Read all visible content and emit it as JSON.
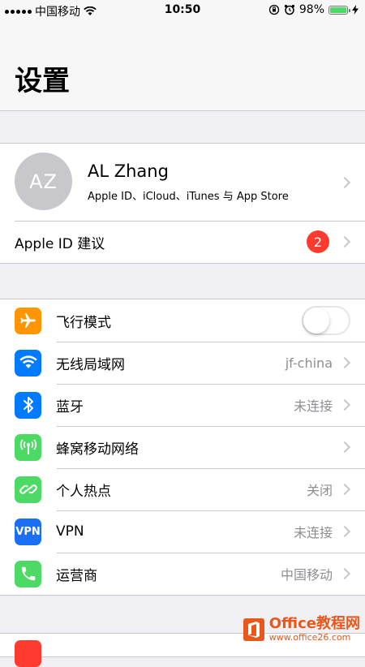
{
  "status_bar": {
    "carrier": "中国移动",
    "time": "10:50",
    "battery": "98%",
    "battery_level": 0.98
  },
  "title": "设置",
  "profile": {
    "initials": "AZ",
    "name": "AL Zhang",
    "subtitle": "Apple ID、iCloud、iTunes 与 App Store"
  },
  "apple_id_suggestion": {
    "label": "Apple ID 建议",
    "badge": "2"
  },
  "settings": [
    {
      "label": "飞行模式",
      "value": "",
      "icon": "airplane-icon",
      "color": "#ff9500",
      "toggle": true,
      "toggle_on": false
    },
    {
      "label": "无线局域网",
      "value": "jf-china",
      "icon": "wifi-icon",
      "color": "#007aff"
    },
    {
      "label": "蓝牙",
      "value": "未连接",
      "icon": "bluetooth-icon",
      "color": "#007aff"
    },
    {
      "label": "蜂窝移动网络",
      "value": "",
      "icon": "cellular-icon",
      "color": "#4cd964"
    },
    {
      "label": "个人热点",
      "value": "关闭",
      "icon": "hotspot-icon",
      "color": "#4cd964"
    },
    {
      "label": "VPN",
      "value": "未连接",
      "icon": "vpn-icon",
      "color": "#1a6ff5",
      "icon_text": "VPN"
    },
    {
      "label": "运营商",
      "value": "中国移动",
      "icon": "phone-icon",
      "color": "#4cd964"
    }
  ],
  "watermark": {
    "main": "Office教程网",
    "sub": "www.office26.com"
  }
}
